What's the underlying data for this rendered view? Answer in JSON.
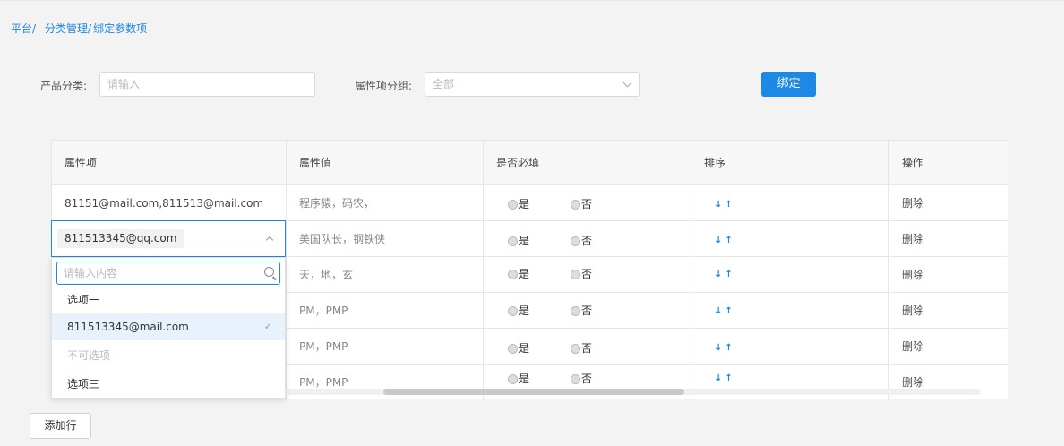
{
  "breadcrumb": [
    "平台/",
    "分类管理/",
    "绑定参数项"
  ],
  "form": {
    "category_label": "产品分类:",
    "category_placeholder": "请输入",
    "group_label": "属性项分组:",
    "group_value": "全部",
    "bind_label": "绑定"
  },
  "table": {
    "headers": [
      "属性项",
      "属性值",
      "是否必填",
      "排序",
      "操作"
    ],
    "rows": [
      {
        "item": "81151@mail.com,811513@mail.com",
        "value": "程序猿，码农，",
        "yes": "是",
        "no": "否",
        "sort": "↓↑",
        "action": "删除"
      },
      {
        "item": "811513345@qq.com",
        "value": "美国队长，钢铁侠",
        "yes": "是",
        "no": "否",
        "sort": "↓↑",
        "action": "删除"
      },
      {
        "item": "",
        "value": "天，地，玄",
        "yes": "是",
        "no": "否",
        "sort": "↓↑",
        "action": "删除"
      },
      {
        "item": "",
        "value": "PM，PMP",
        "yes": "是",
        "no": "否",
        "sort": "↓↑",
        "action": "删除"
      },
      {
        "item": "",
        "value": "PM，PMP",
        "yes": "是",
        "no": "否",
        "sort": "↓↑",
        "action": "删除"
      },
      {
        "item": "",
        "value": "PM，PMP",
        "yes": "是",
        "no": "否",
        "sort": "↓↑",
        "action": "删除"
      }
    ]
  },
  "dropdown": {
    "search_placeholder": "请输入内容",
    "options": [
      {
        "label": "选项一"
      },
      {
        "label": "811513345@mail.com"
      },
      {
        "label": "不可选项"
      },
      {
        "label": "选项三"
      }
    ],
    "check": "✓"
  },
  "add_row_label": "添加行",
  "colors": {
    "accent": "#1e88e5"
  }
}
